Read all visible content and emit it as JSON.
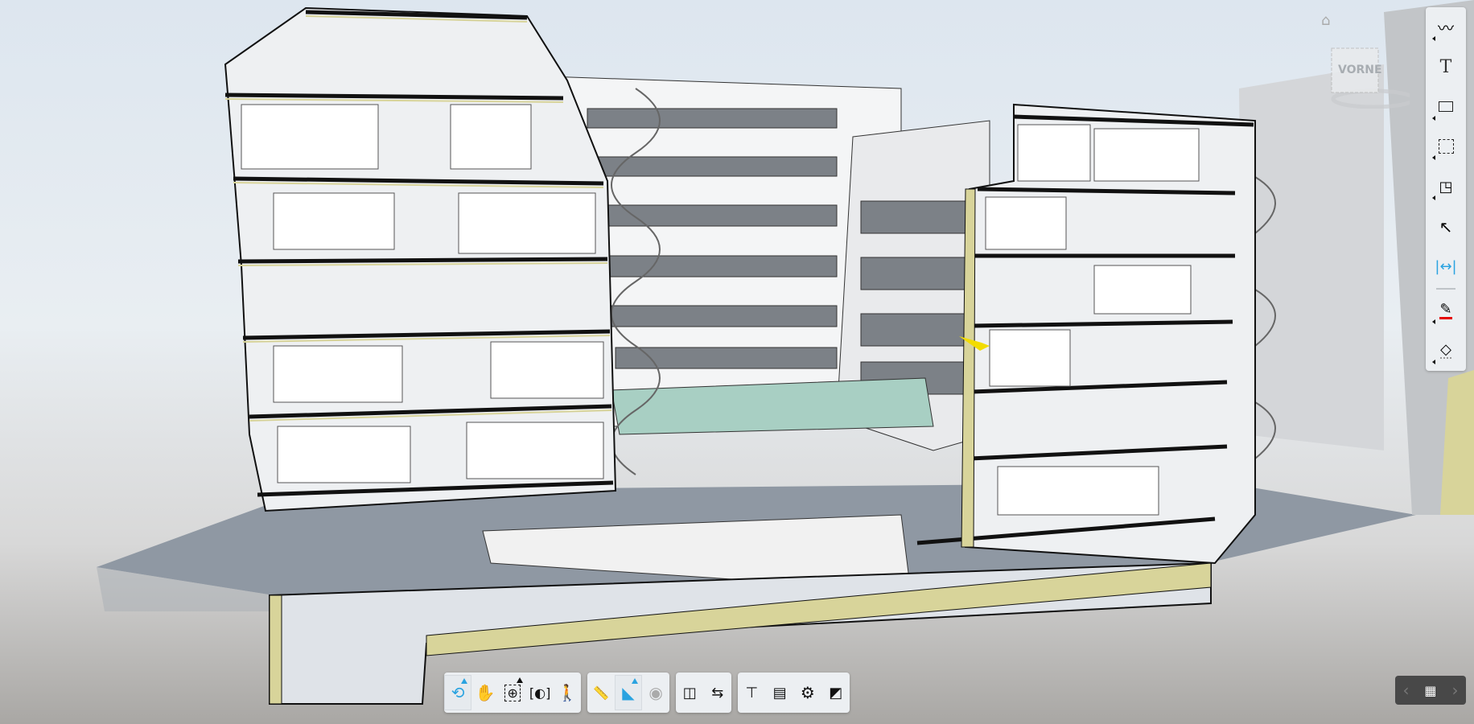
{
  "viewcube": {
    "face_label": "VORNE"
  },
  "colors": {
    "accent": "#2aa3e0",
    "toolbar_bg": "#eceff2",
    "nav_bg": "#484848",
    "pen_color": "#e60000",
    "section_fill": "#d8d49a"
  },
  "bottom_toolbar": {
    "groups": [
      {
        "items": [
          {
            "icon": "orbit-icon",
            "active": true
          },
          {
            "icon": "pan-hand-icon"
          },
          {
            "icon": "zoom-window-icon"
          },
          {
            "icon": "fit-to-view-icon"
          },
          {
            "icon": "first-person-icon"
          }
        ]
      },
      {
        "items": [
          {
            "icon": "measure-ruler-icon"
          },
          {
            "icon": "section-plane-icon",
            "active": true
          },
          {
            "icon": "explode-hidden-icon",
            "disabled": true
          }
        ]
      },
      {
        "items": [
          {
            "icon": "split-view-icon"
          },
          {
            "icon": "swap-arrows-icon"
          }
        ]
      },
      {
        "items": [
          {
            "icon": "model-tree-icon"
          },
          {
            "icon": "properties-icon"
          },
          {
            "icon": "settings-gear-icon"
          },
          {
            "icon": "fullscreen-icon"
          }
        ]
      }
    ]
  },
  "markup_toolbar": {
    "items": [
      "freehand-icon",
      "text-icon",
      "callout-icon",
      "cloud-icon",
      "shape-icon",
      "arrow-icon",
      "dimension-icon",
      "pen-color-icon",
      "fill-icon"
    ]
  },
  "nav": {
    "prev": "‹",
    "next": "›"
  }
}
